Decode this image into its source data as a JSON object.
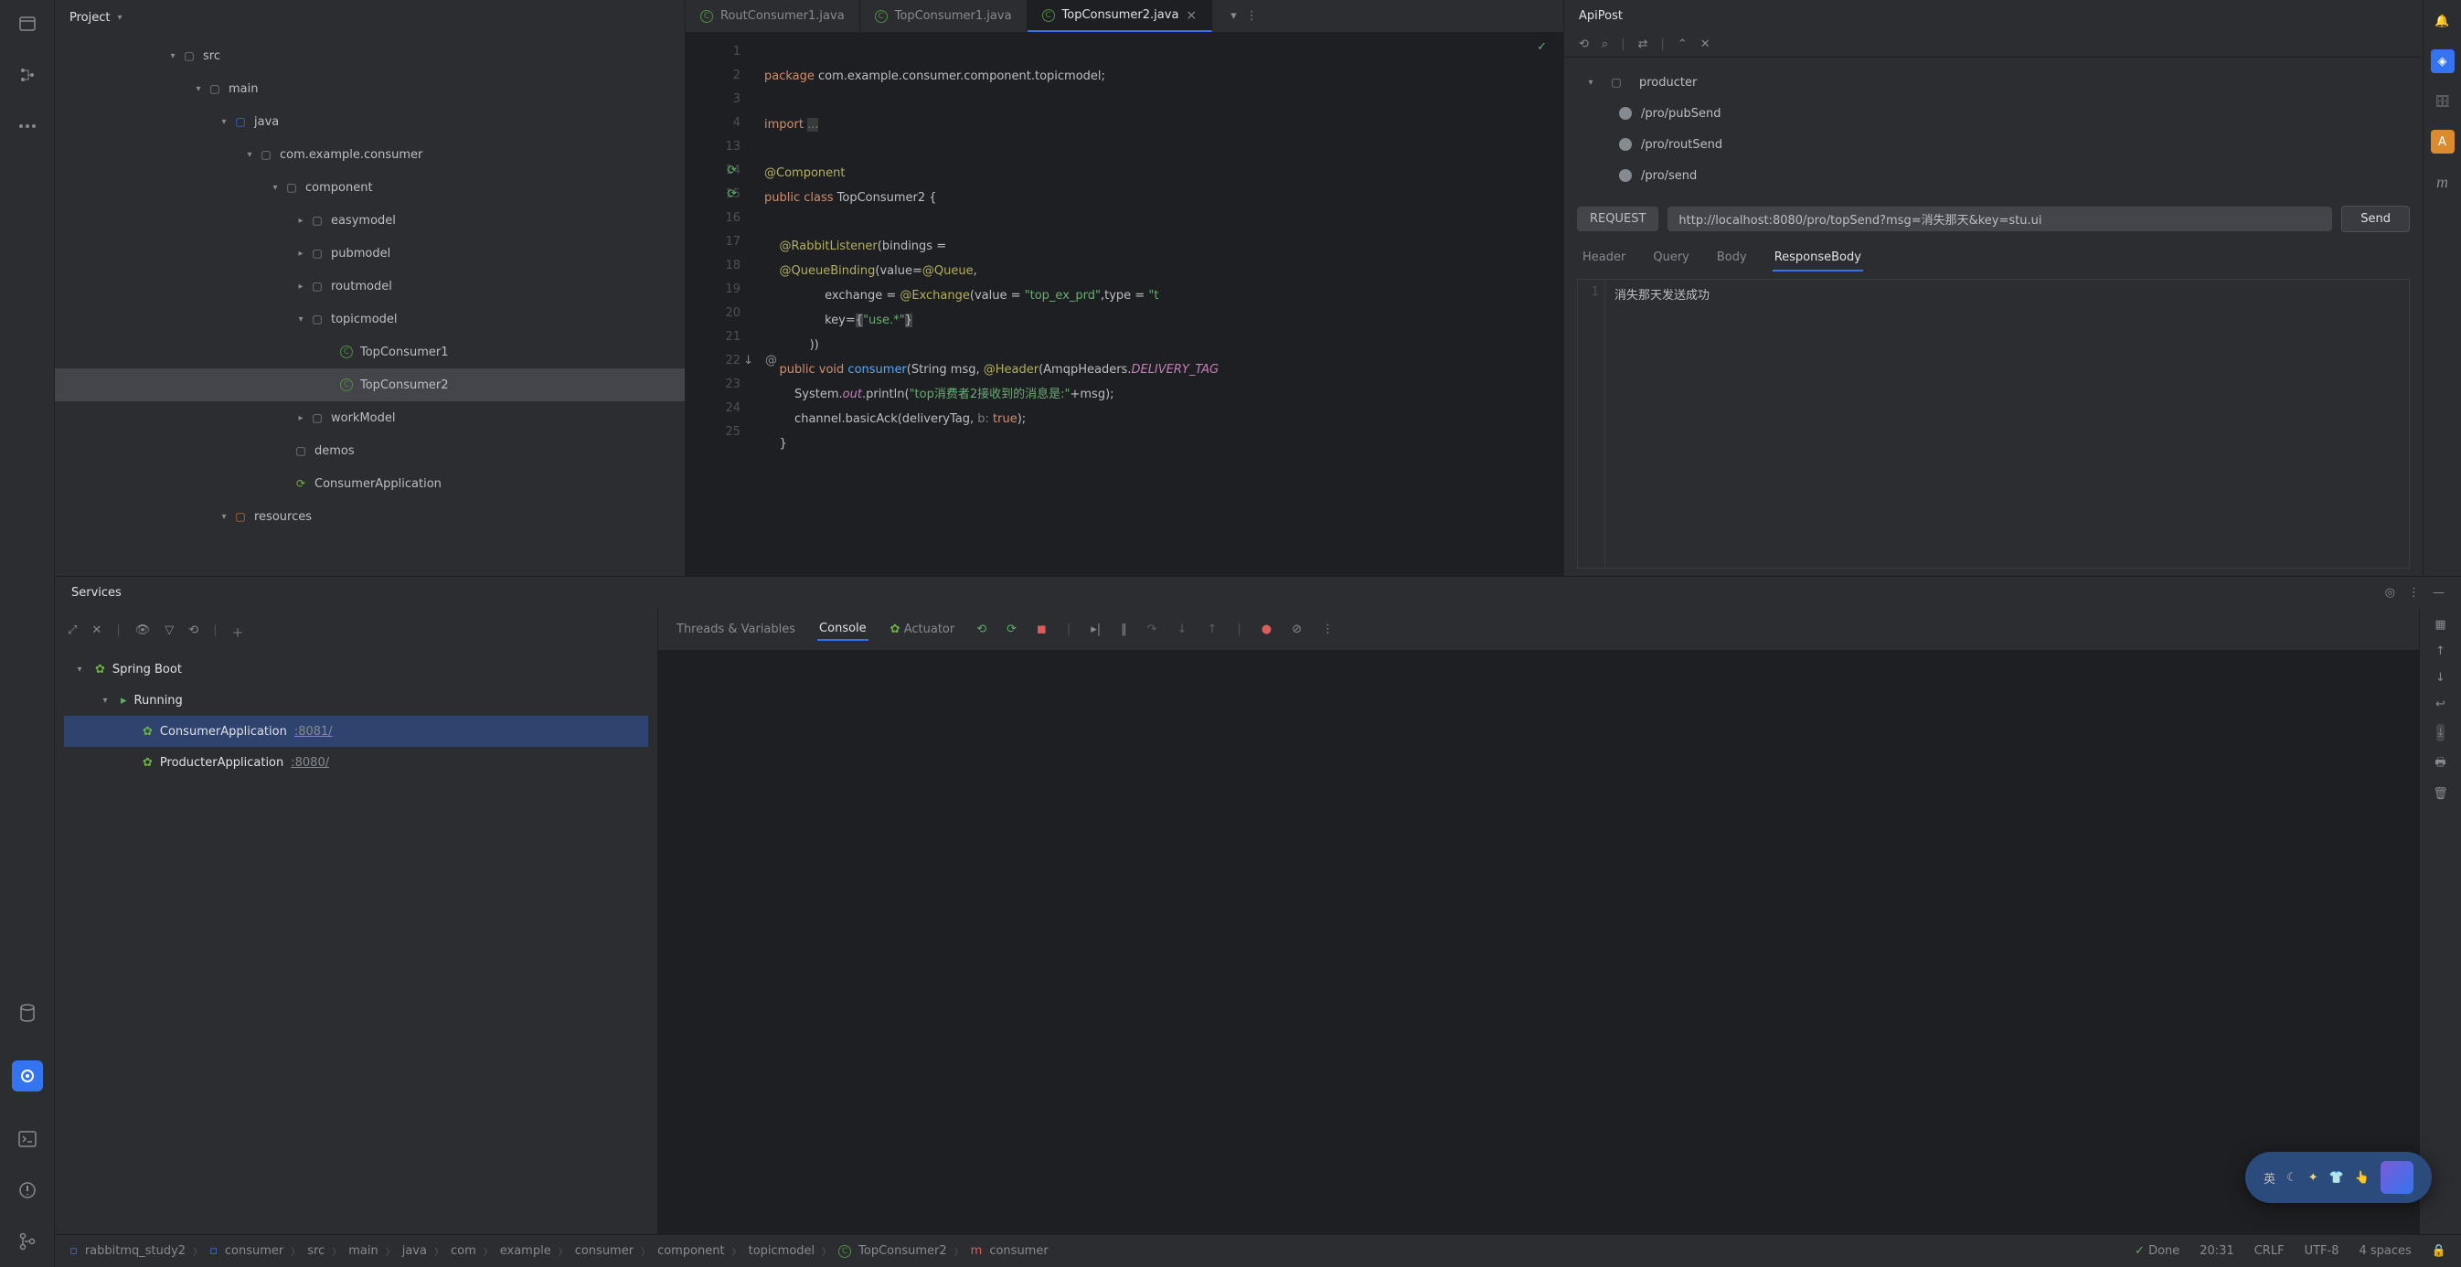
{
  "project": {
    "title": "Project"
  },
  "tree": {
    "src": "src",
    "main": "main",
    "java": "java",
    "pkg": "com.example.consumer",
    "component": "component",
    "easymodel": "easymodel",
    "pubmodel": "pubmodel",
    "routmodel": "routmodel",
    "topicmodel": "topicmodel",
    "tc1": "TopConsumer1",
    "tc2": "TopConsumer2",
    "workModel": "workModel",
    "demos": "demos",
    "consumerApp": "ConsumerApplication",
    "resources": "resources"
  },
  "tabs": {
    "t1": "RoutConsumer1.java",
    "t2": "TopConsumer1.java",
    "t3": "TopConsumer2.java"
  },
  "lines": [
    "1",
    "2",
    "3",
    "4",
    "13",
    "14",
    "15",
    "16",
    "17",
    "18",
    "19",
    "20",
    "21",
    "22",
    "23",
    "24",
    "25"
  ],
  "code": {
    "l1a": "package",
    "l1b": " com.example.consumer.component.topicmodel;",
    "l3a": "import ",
    "l3b": "...",
    "l5": "@Component",
    "l6a": "public class ",
    "l6b": "TopConsumer2 ",
    "l6c": "{",
    "l8": "    @RabbitListener",
    "l8b": "(bindings =",
    "l9": "    @QueueBinding",
    "l9b": "(value=",
    "l9c": "@Queue",
    "l9d": ",",
    "l10a": "                exchange = ",
    "l10b": "@Exchange",
    "l10c": "(value = ",
    "l10d": "\"top_ex_prd\"",
    "l10e": ",type = ",
    "l10f": "\"t",
    "l11a": "                key=",
    "l11b": "{",
    "l11c": "\"use.*\"",
    "l11d": "}",
    "l12": "            ))",
    "l13a": "    public void ",
    "l13b": "consumer",
    "l13c": "(String msg, ",
    "l13d": "@Header",
    "l13e": "(AmqpHeaders.",
    "l13f": "DELIVERY_TAG",
    "l14a": "        System.",
    "l14b": "out",
    "l14c": ".println(",
    "l14d": "\"top消费者2接收到的消息是:\"",
    "l14e": "+msg);",
    "l15a": "        channel.basicAck(deliveryTag, ",
    "l15p": "b:",
    "l15b": " true",
    "l15c": ");",
    "l16": "    }"
  },
  "api": {
    "title": "ApiPost",
    "root": "producter",
    "ep1": "/pro/pubSend",
    "ep2": "/pro/routSend",
    "ep3": "/pro/send",
    "reqLabel": "REQUEST",
    "url": "http://localhost:8080/pro/topSend?msg=消失那天&key=stu.ui",
    "send": "Send",
    "tabHeader": "Header",
    "tabQuery": "Query",
    "tabBody": "Body",
    "tabResp": "ResponseBody",
    "respLine": "1",
    "respText": "消失那天发送成功"
  },
  "services": {
    "title": "Services",
    "threadsTab": "Threads & Variables",
    "consoleTab": "Console",
    "actuatorTab": "Actuator",
    "springBoot": "Spring Boot",
    "running": "Running",
    "app1": "ConsumerApplication",
    "app1port": ":8081/",
    "app2": "ProducterApplication",
    "app2port": ":8080/"
  },
  "breadcrumb": {
    "b0": "rabbitmq_study2",
    "b1": "consumer",
    "b2": "src",
    "b3": "main",
    "b4": "java",
    "b5": "com",
    "b6": "example",
    "b7": "consumer",
    "b8": "component",
    "b9": "topicmodel",
    "b10": "TopConsumer2",
    "b11": "consumer"
  },
  "status": {
    "done": "Done",
    "time": "20:31",
    "crlf": "CRLF",
    "enc": "UTF-8",
    "indent": "4 spaces"
  },
  "pill": "英"
}
